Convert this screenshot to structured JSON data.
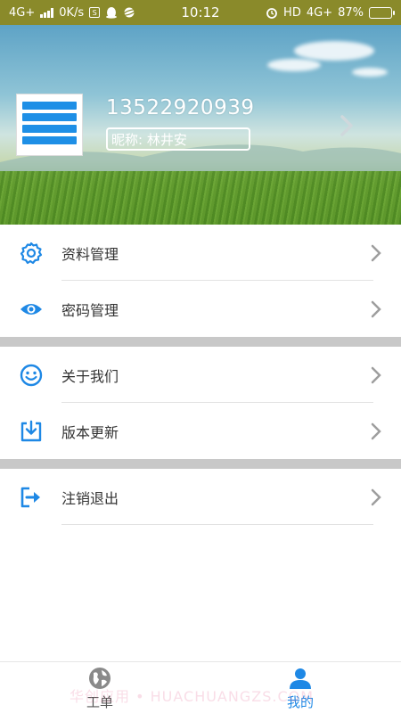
{
  "status_bar": {
    "network_left": "4G+",
    "speed": "0K/s",
    "time": "10:12",
    "hd": "HD",
    "network_right": "4G+",
    "battery": "87%",
    "battery_level": 0.87,
    "icons": [
      "signal-icon",
      "s-app-icon",
      "qq-penguin-icon",
      "browser-planet-icon",
      "alarm-icon",
      "battery-icon"
    ]
  },
  "profile": {
    "phone": "13522920939",
    "nickname": "昵称: 林井安",
    "avatar_icon": "app-screenshot-thumbnail"
  },
  "menu": {
    "items": [
      {
        "label": "资料管理",
        "icon": "gear-icon"
      },
      {
        "label": "密码管理",
        "icon": "eye-icon"
      },
      {
        "label": "关于我们",
        "icon": "smiley-icon"
      },
      {
        "label": "版本更新",
        "icon": "download-icon"
      },
      {
        "label": "注销退出",
        "icon": "logout-icon"
      }
    ]
  },
  "bottom_nav": {
    "tabs": [
      {
        "label": "工单",
        "icon": "globe-icon",
        "active": false
      },
      {
        "label": "我的",
        "icon": "person-icon",
        "active": true
      }
    ]
  },
  "watermark": "华创应用 • HUACHUANGZS.COM",
  "colors": {
    "accent": "#1e88e5",
    "status_bar": "#8a8a2a",
    "separator": "#c8c8c8"
  }
}
